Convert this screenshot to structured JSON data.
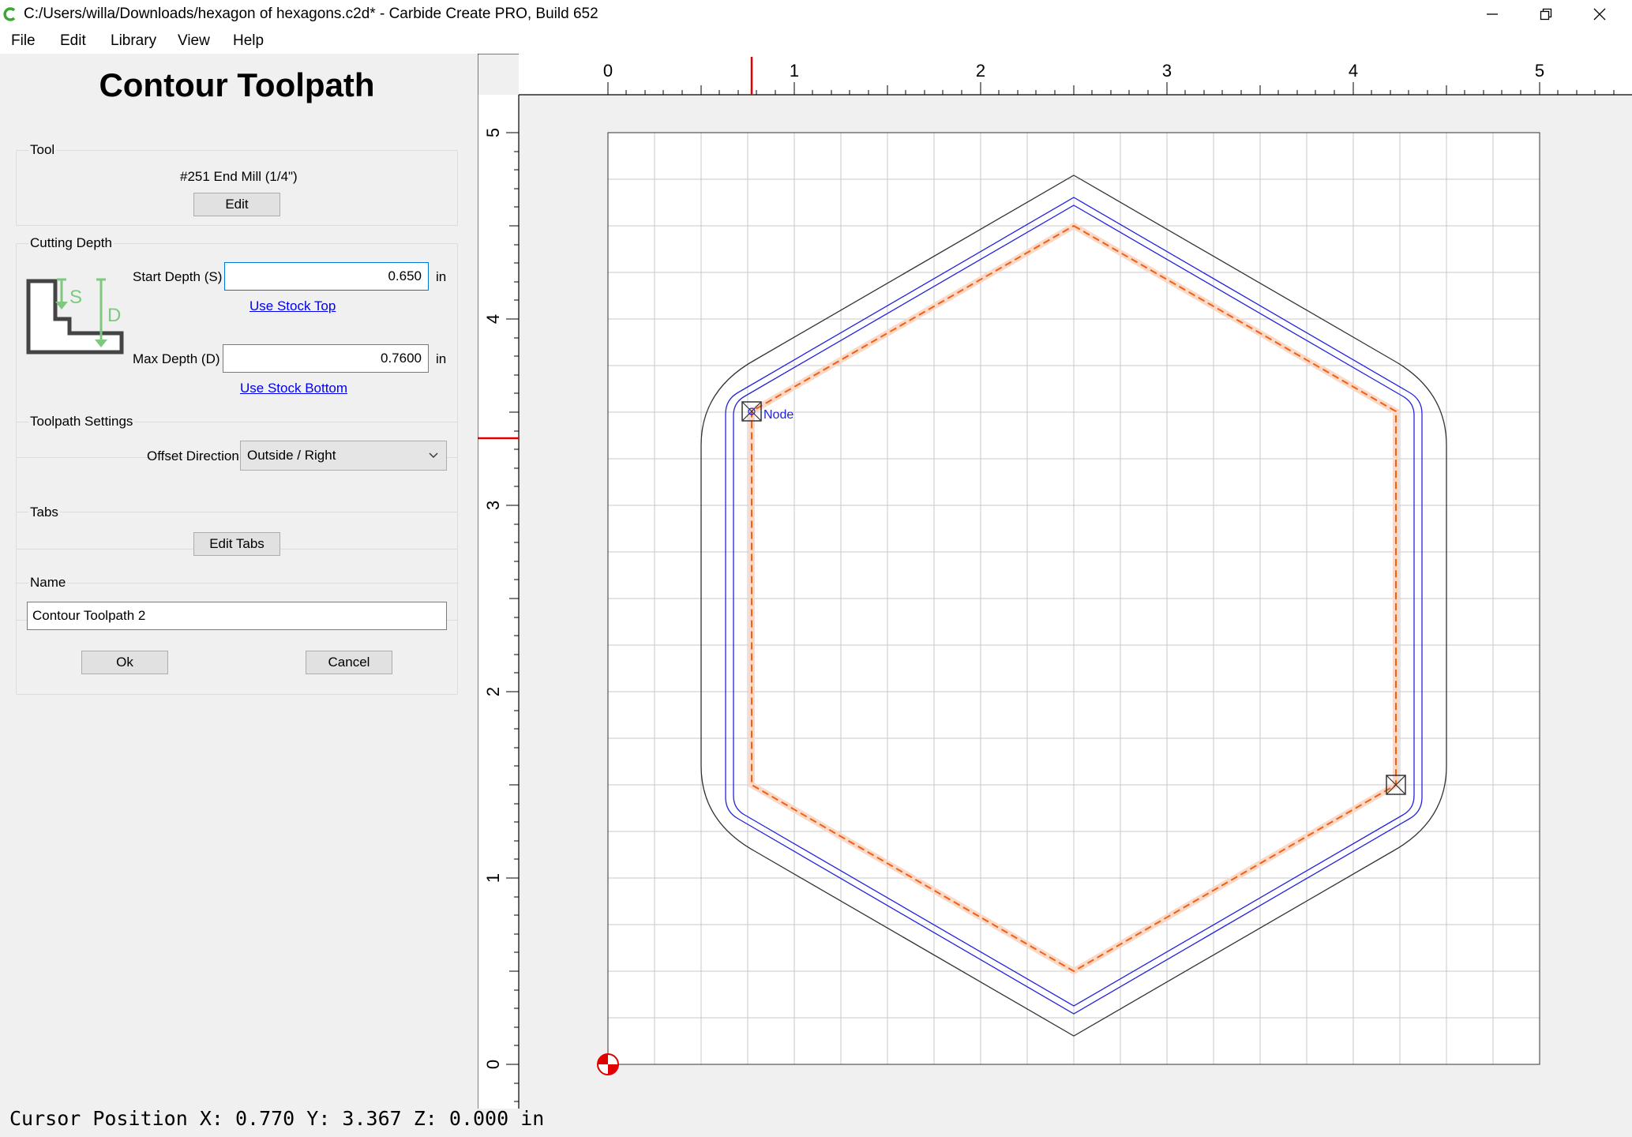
{
  "window": {
    "title": "C:/Users/willa/Downloads/hexagon of hexagons.c2d* - Carbide Create PRO, Build 652"
  },
  "menu": {
    "items": [
      "File",
      "Edit",
      "Library",
      "View",
      "Help"
    ]
  },
  "panel": {
    "title": "Contour Toolpath",
    "tool": {
      "group_label": "Tool",
      "name": "#251 End Mill (1/4\")",
      "edit_label": "Edit"
    },
    "cutting_depth": {
      "group_label": "Cutting Depth",
      "start_label": "Start Depth (S)",
      "start_value": "0.650",
      "start_unit": "in",
      "use_stock_top": "Use Stock Top",
      "max_label": "Max Depth (D)",
      "max_value": "0.7600",
      "max_unit": "in",
      "use_stock_bottom": "Use Stock Bottom",
      "diagram_s": "S",
      "diagram_d": "D"
    },
    "toolpath_settings": {
      "group_label": "Toolpath Settings",
      "offset_label": "Offset Direction",
      "offset_value": "Outside / Right"
    },
    "tabs": {
      "group_label": "Tabs",
      "edit_tabs_label": "Edit Tabs"
    },
    "name": {
      "group_label": "Name",
      "value": "Contour Toolpath 2"
    },
    "ok_label": "Ok",
    "cancel_label": "Cancel"
  },
  "canvas": {
    "x_ticks": [
      "0",
      "1",
      "2",
      "3",
      "4",
      "5"
    ],
    "y_ticks": [
      "0",
      "1",
      "2",
      "3",
      "4",
      "5"
    ],
    "node_label": "Node",
    "colors": {
      "grid": "#c8c8c8",
      "stock_border": "#555555",
      "outline_offset": "#333333",
      "path_blue": "#2222dd",
      "toolpath_orange": "#f06010",
      "cursor_marker": "#e00000"
    }
  },
  "status": {
    "text": "Cursor Position X: 0.770 Y: 3.367 Z: 0.000 in"
  }
}
